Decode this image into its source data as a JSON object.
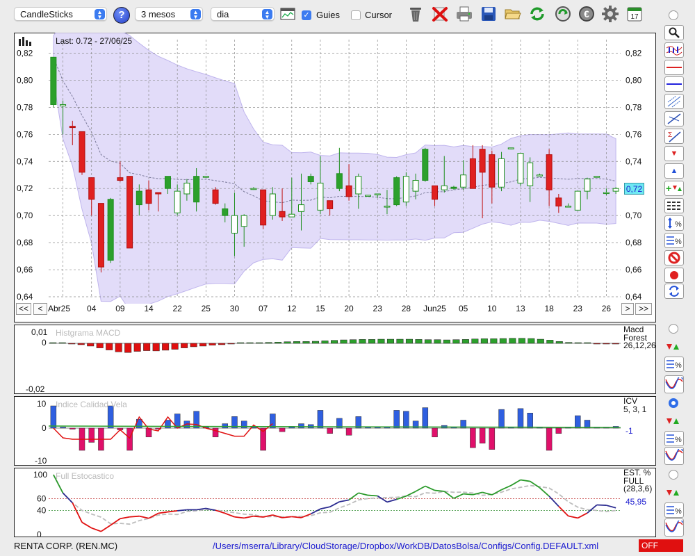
{
  "toolbar": {
    "chart_type": "CandleSticks",
    "help_label": "?",
    "period": "3 mesos",
    "interval": "dia",
    "guides_label": "Guies",
    "guides_checked": true,
    "cursor_label": "Cursor",
    "cursor_checked": false,
    "calendar_day": "17",
    "icons": [
      "chart-icon",
      "trash-icon",
      "delete-icon",
      "printer-icon",
      "save-icon",
      "open-folder-icon",
      "refresh-icon",
      "download-icon",
      "euro-icon",
      "gear-icon",
      "calendar-icon"
    ]
  },
  "main_chart": {
    "last_label": "Last: 0.72 - 27/06/25",
    "current_price": "0,72",
    "y_ticks": [
      "0,82",
      "0,80",
      "0,78",
      "0,76",
      "0,74",
      "0,72",
      "0,70",
      "0,68",
      "0,66",
      "0,64"
    ],
    "x_labels": [
      "Abr25",
      "04",
      "09",
      "14",
      "22",
      "25",
      "30",
      "07",
      "12",
      "15",
      "20",
      "23",
      "28",
      "Jun25",
      "05",
      "10",
      "13",
      "18",
      "23",
      "26"
    ],
    "nav": {
      "first": "<<",
      "prev": "<",
      "next": ">",
      "last": ">>"
    }
  },
  "macd": {
    "title": "Histgrama MACD",
    "y_ticks": [
      "0,01",
      "0",
      "-0,02"
    ],
    "label1": "Macd",
    "label2": "Forest",
    "params": "26,12,26"
  },
  "icv": {
    "title": "Indice Calidad Vela",
    "y_ticks": [
      "10",
      "0",
      "-10"
    ],
    "label": "ICV",
    "params": "5, 3, 1",
    "value": "-1"
  },
  "stoch": {
    "title": "Full Estocastico",
    "y_ticks": [
      "100",
      "60",
      "40",
      "0"
    ],
    "label1": "EST. %",
    "label2": "FULL",
    "params": "(28,3,6)",
    "value": "45,95"
  },
  "status": {
    "company": "RENTA CORP. (REN.MC)",
    "path": "/Users/mserra/Library/CloudStorage/Dropbox/WorkDB/DatosBolsa/Configs/Config.DEFAULT.xml",
    "mode": "OFF"
  },
  "colors": {
    "up": "#22a022",
    "down": "#e02020",
    "band": "#d9d2f7",
    "accent": "#3b7bf0"
  },
  "chart_data": {
    "type": "candlestick",
    "y_range": [
      0.64,
      0.83
    ],
    "candles": [
      [
        0.782,
        0.817,
        0.817,
        0.78
      ],
      [
        0.781,
        0.782,
        0.785,
        0.76
      ],
      [
        0.766,
        0.765,
        0.77,
        0.752
      ],
      [
        0.762,
        0.732,
        0.762,
        0.73
      ],
      [
        0.728,
        0.712,
        0.728,
        0.7
      ],
      [
        0.709,
        0.662,
        0.709,
        0.658
      ],
      [
        0.667,
        0.712,
        0.713,
        0.665
      ],
      [
        0.728,
        0.726,
        0.74,
        0.725
      ],
      [
        0.729,
        0.676,
        0.729,
        0.676
      ],
      [
        0.708,
        0.718,
        0.723,
        0.7
      ],
      [
        0.719,
        0.709,
        0.726,
        0.704
      ],
      [
        0.717,
        0.716,
        0.717,
        0.703
      ],
      [
        0.72,
        0.729,
        0.729,
        0.716
      ],
      [
        0.702,
        0.718,
        0.723,
        0.7
      ],
      [
        0.716,
        0.724,
        0.727,
        0.711
      ],
      [
        0.71,
        0.729,
        0.735,
        0.703
      ],
      [
        0.729,
        0.729,
        0.729,
        0.728
      ],
      [
        0.719,
        0.709,
        0.721,
        0.708
      ],
      [
        0.7,
        0.705,
        0.709,
        0.695
      ],
      [
        0.687,
        0.7,
        0.717,
        0.67
      ],
      [
        0.692,
        0.7,
        0.701,
        0.677
      ],
      [
        0.72,
        0.72,
        0.721,
        0.719
      ],
      [
        0.719,
        0.693,
        0.719,
        0.69
      ],
      [
        0.7,
        0.716,
        0.721,
        0.697
      ],
      [
        0.703,
        0.699,
        0.72,
        0.696
      ],
      [
        0.699,
        0.701,
        0.728,
        0.699
      ],
      [
        0.703,
        0.708,
        0.731,
        0.689
      ],
      [
        0.725,
        0.729,
        0.731,
        0.723
      ],
      [
        0.704,
        0.724,
        0.744,
        0.701
      ],
      [
        0.711,
        0.705,
        0.71,
        0.7
      ],
      [
        0.72,
        0.731,
        0.75,
        0.718
      ],
      [
        0.722,
        0.714,
        0.738,
        0.711
      ],
      [
        0.716,
        0.729,
        0.731,
        0.705
      ],
      [
        0.715,
        0.715,
        0.715,
        0.715
      ],
      [
        0.716,
        0.716,
        0.716,
        0.713
      ],
      [
        0.707,
        0.707,
        0.719,
        0.701
      ],
      [
        0.708,
        0.728,
        0.729,
        0.707
      ],
      [
        0.71,
        0.729,
        0.732,
        0.707
      ],
      [
        0.718,
        0.726,
        0.731,
        0.712
      ],
      [
        0.726,
        0.749,
        0.75,
        0.725
      ],
      [
        0.722,
        0.712,
        0.722,
        0.707
      ],
      [
        0.719,
        0.722,
        0.744,
        0.717
      ],
      [
        0.72,
        0.721,
        0.722,
        0.719
      ],
      [
        0.721,
        0.73,
        0.741,
        0.719
      ],
      [
        0.742,
        0.72,
        0.752,
        0.72
      ],
      [
        0.749,
        0.732,
        0.752,
        0.698
      ],
      [
        0.745,
        0.721,
        0.748,
        0.709
      ],
      [
        0.721,
        0.742,
        0.747,
        0.718
      ],
      [
        0.75,
        0.75,
        0.75,
        0.749
      ],
      [
        0.724,
        0.746,
        0.746,
        0.722
      ],
      [
        0.722,
        0.739,
        0.743,
        0.71
      ],
      [
        0.73,
        0.73,
        0.731,
        0.729
      ],
      [
        0.745,
        0.719,
        0.749,
        0.707
      ],
      [
        0.713,
        0.707,
        0.716,
        0.702
      ],
      [
        0.707,
        0.707,
        0.709,
        0.707
      ],
      [
        0.704,
        0.718,
        0.718,
        0.704
      ],
      [
        0.718,
        0.727,
        0.728,
        0.712
      ],
      [
        0.729,
        0.729,
        0.729,
        0.729
      ],
      [
        0.717,
        0.717,
        0.72,
        0.715
      ],
      [
        0.718,
        0.72,
        0.721,
        0.716
      ]
    ],
    "macd_hist": [
      0,
      0,
      -0.0002,
      -0.0006,
      -0.0012,
      -0.002,
      -0.0029,
      -0.0037,
      -0.004,
      -0.0035,
      -0.0032,
      -0.0033,
      -0.003,
      -0.0026,
      -0.002,
      -0.0015,
      -0.0012,
      -0.0008,
      -0.0006,
      -0.0003,
      0,
      0,
      0.0001,
      0.0004,
      0.0005,
      0.0007,
      0.0008,
      0.0008,
      0.0009,
      0.0011,
      0.0013,
      0.0015,
      0.0016,
      0.0017,
      0.0017,
      0.0018,
      0.0018,
      0.0018,
      0.0018,
      0.0017,
      0.0016,
      0.0016,
      0.0015,
      0.0016,
      0.0017,
      0.0019,
      0.002,
      0.002,
      0.0021,
      0.0022,
      0.0022,
      0.0021,
      0.0018,
      0.0014,
      0.0008,
      0.0004,
      0.0002,
      0.0,
      -0.0001,
      -0.0002,
      -0.0002
    ]
  }
}
